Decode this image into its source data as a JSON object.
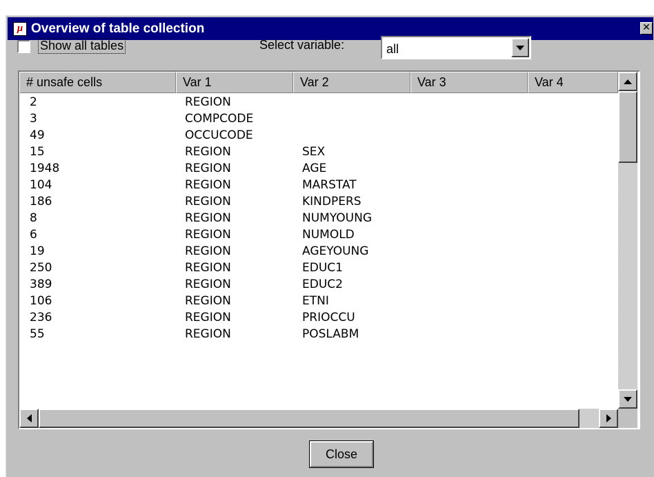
{
  "window": {
    "title": "Overview of table collection",
    "close_glyph": "✕",
    "icon_letter": "μ",
    "icon": "app-icon"
  },
  "options": {
    "show_all_label": "Show all tables",
    "show_all_checked": false,
    "select_label": "Select variable:",
    "select_value": "all"
  },
  "table": {
    "headers": [
      "# unsafe cells",
      "Var 1",
      "Var 2",
      "Var 3",
      "Var 4"
    ],
    "rows": [
      {
        "count": "2",
        "var1": "REGION",
        "var2": ""
      },
      {
        "count": "3",
        "var1": "COMPCODE",
        "var2": ""
      },
      {
        "count": "49",
        "var1": "OCCUCODE",
        "var2": ""
      },
      {
        "count": "15",
        "var1": "REGION",
        "var2": "SEX"
      },
      {
        "count": "1948",
        "var1": "REGION",
        "var2": "AGE"
      },
      {
        "count": "104",
        "var1": "REGION",
        "var2": "MARSTAT"
      },
      {
        "count": "186",
        "var1": "REGION",
        "var2": "KINDPERS"
      },
      {
        "count": "8",
        "var1": "REGION",
        "var2": "NUMYOUNG"
      },
      {
        "count": "6",
        "var1": "REGION",
        "var2": "NUMOLD"
      },
      {
        "count": "19",
        "var1": "REGION",
        "var2": "AGEYOUNG"
      },
      {
        "count": "250",
        "var1": "REGION",
        "var2": "EDUC1"
      },
      {
        "count": "389",
        "var1": "REGION",
        "var2": "EDUC2"
      },
      {
        "count": "106",
        "var1": "REGION",
        "var2": "ETNI"
      },
      {
        "count": "236",
        "var1": "REGION",
        "var2": "PRIOCCU"
      },
      {
        "count": "55",
        "var1": "REGION",
        "var2": "POSLABM"
      }
    ]
  },
  "buttons": {
    "close_label": "Close"
  },
  "colors": {
    "titlebar": "#000080",
    "face": "#c0c0c0",
    "app_icon": "#c00000"
  }
}
